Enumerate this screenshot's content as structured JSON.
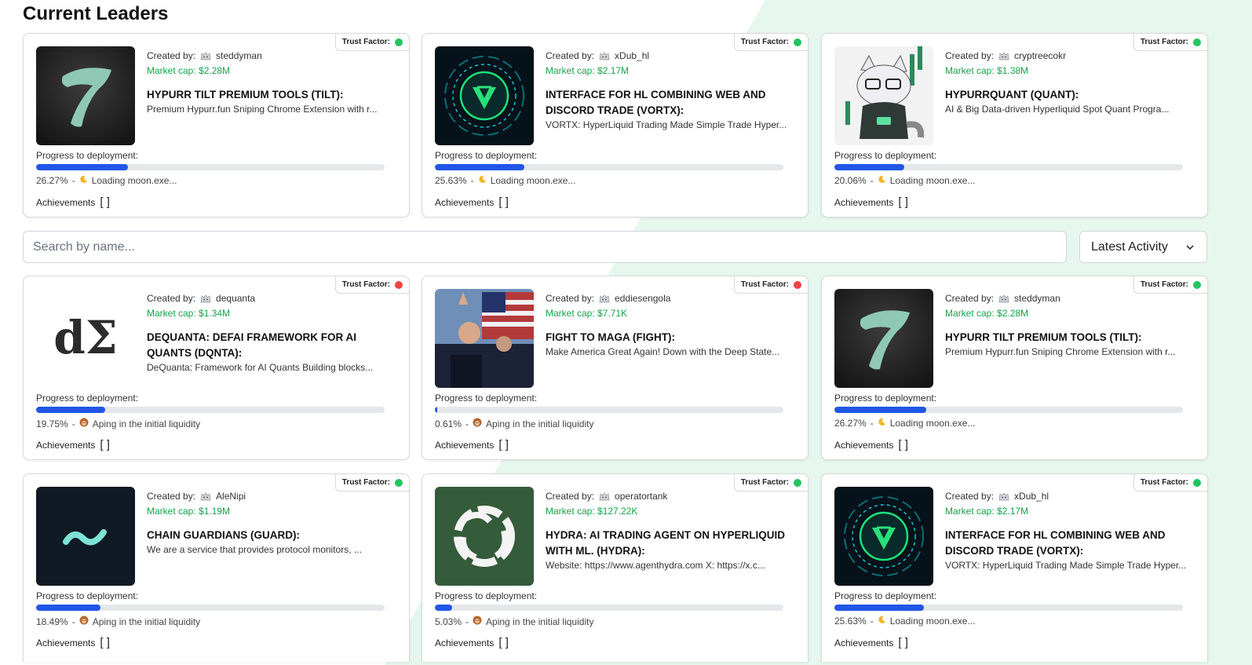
{
  "section_title": "Current Leaders",
  "search": {
    "placeholder": "Search by name..."
  },
  "sort": {
    "selected": "Latest Activity"
  },
  "labels": {
    "created_by": "Created by:",
    "progress": "Progress to deployment:",
    "trust": "Trust Factor:",
    "achievements": "Achievements",
    "ach_brackets": "[ ]"
  },
  "colors": {
    "accent_blue": "#2156e6",
    "green": "#22c55e",
    "red": "#ef4444",
    "mcap_green": "#16a34a",
    "bg_mint": "#e6f7ee"
  },
  "cards": [
    {
      "creator": "steddyman",
      "mcap": "Market cap: $2.28M",
      "name": "HYPURR TILT PREMIUM TOOLS (TILT):",
      "desc": "Premium Hypurr.fun Sniping Chrome Extension with r...",
      "pct": "26.27%",
      "progress": 26.27,
      "status_icon": "moon-icon",
      "status": "Loading moon.exe...",
      "trust": "green",
      "thumb": "tilt"
    },
    {
      "creator": "xDub_hl",
      "mcap": "Market cap: $2.17M",
      "name": "INTERFACE FOR HL COMBINING WEB AND DISCORD TRADE (VORTX):",
      "desc": "VORTX: HyperLiquid Trading Made Simple Trade Hyper...",
      "pct": "25.63%",
      "progress": 25.63,
      "status_icon": "moon-icon",
      "status": "Loading moon.exe...",
      "trust": "green",
      "thumb": "vortx"
    },
    {
      "creator": "cryptreecokr",
      "mcap": "Market cap: $1.38M",
      "name": "HYPURRQUANT (QUANT):",
      "desc": "AI & Big Data-driven Hyperliquid Spot Quant Progra...",
      "pct": "20.06%",
      "progress": 20.06,
      "status_icon": "moon-icon",
      "status": "Loading moon.exe...",
      "trust": "green",
      "thumb": "cat"
    },
    {
      "creator": "dequanta",
      "mcap": "Market cap: $1.34M",
      "name": "DEQUANTA: DEFAI FRAMEWORK FOR AI QUANTS (DQNTA):",
      "desc": "DeQuanta: Framework for AI Quants Building blocks...",
      "pct": "19.75%",
      "progress": 19.75,
      "status_icon": "ape-icon",
      "status": "Aping in the initial liquidity",
      "trust": "red",
      "thumb": "dsigma"
    },
    {
      "creator": "eddiesengola",
      "mcap": "Market cap: $7.71K",
      "name": "FIGHT TO MAGA (FIGHT):",
      "desc": "Make America Great Again! Down with the Deep State...",
      "pct": "0.61%",
      "progress": 0.61,
      "status_icon": "ape-icon",
      "status": "Aping in the initial liquidity",
      "trust": "red",
      "thumb": "flag"
    },
    {
      "creator": "steddyman",
      "mcap": "Market cap: $2.28M",
      "name": "HYPURR TILT PREMIUM TOOLS (TILT):",
      "desc": "Premium Hypurr.fun Sniping Chrome Extension with r...",
      "pct": "26.27%",
      "progress": 26.27,
      "status_icon": "moon-icon",
      "status": "Loading moon.exe...",
      "trust": "green",
      "thumb": "tilt"
    },
    {
      "creator": "AleNipi",
      "mcap": "Market cap: $1.19M",
      "name": "CHAIN GUARDIANS (GUARD):",
      "desc": "We are a service that provides protocol monitors, ...",
      "pct": "18.49%",
      "progress": 18.49,
      "status_icon": "ape-icon",
      "status": "Aping in the initial liquidity",
      "trust": "green",
      "thumb": "wave"
    },
    {
      "creator": "operatortank",
      "mcap": "Market cap: $127.22K",
      "name": "HYDRA: AI TRADING AGENT ON HYPERLIQUID WITH ML. (HYDRA):",
      "desc": "Website: https://www.agenthydra.com X: https://x.c...",
      "pct": "5.03%",
      "progress": 5.03,
      "status_icon": "ape-icon",
      "status": "Aping in the initial liquidity",
      "trust": "green",
      "thumb": "hydra"
    },
    {
      "creator": "xDub_hl",
      "mcap": "Market cap: $2.17M",
      "name": "INTERFACE FOR HL COMBINING WEB AND DISCORD TRADE (VORTX):",
      "desc": "VORTX: HyperLiquid Trading Made Simple Trade Hyper...",
      "pct": "25.63%",
      "progress": 25.63,
      "status_icon": "moon-icon",
      "status": "Loading moon.exe...",
      "trust": "green",
      "thumb": "vortx"
    }
  ]
}
